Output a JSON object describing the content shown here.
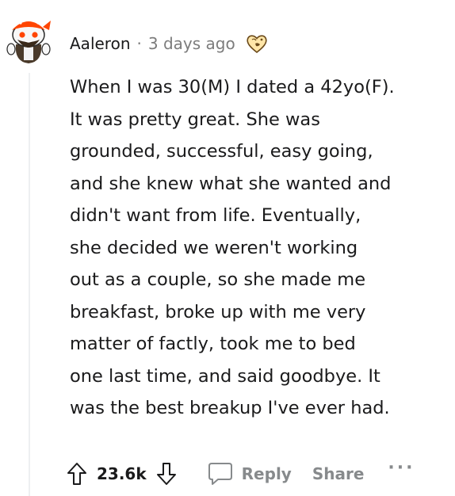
{
  "comment": {
    "author": "Aaleron",
    "separator": "·",
    "timestamp": "3 days ago",
    "award_icon": "heart-award-icon",
    "body_lines": [
      "When I was 30(M) I dated a 42yo(F).",
      "It was pretty great. She was",
      "grounded, successful, easy going,",
      "and she knew what she wanted and",
      "didn't want from life. Eventually,",
      "she decided we weren't working",
      "out as a couple, so she made me",
      "breakfast, broke up with me very",
      "matter of factly, took me to bed",
      "one last time, and said goodbye. It",
      "was the best breakup I've ever had."
    ]
  },
  "actions": {
    "upvote_icon": "upvote-arrow-icon",
    "score": "23.6k",
    "downvote_icon": "downvote-arrow-icon",
    "reply_icon": "speech-bubble-icon",
    "reply_label": "Reply",
    "share_label": "Share",
    "more_label": "···"
  },
  "colors": {
    "text": "#1a1a1b",
    "muted": "#878a8c",
    "avatar_orange": "#ff4500"
  }
}
